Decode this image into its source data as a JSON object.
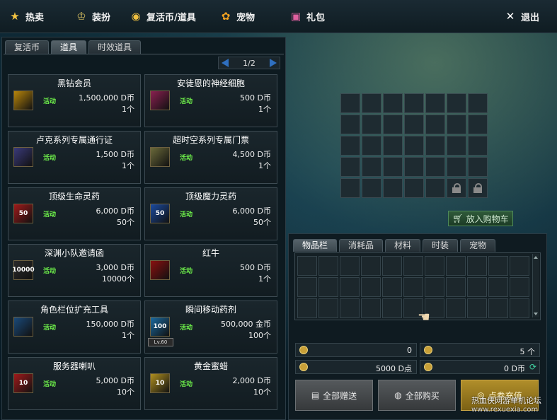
{
  "nav": {
    "hot": "热卖",
    "dress": "装扮",
    "revive": "复活币/道具",
    "pet": "宠物",
    "gift": "礼包",
    "exit": "退出"
  },
  "left": {
    "tabs": [
      "复活币",
      "道具",
      "时效道具"
    ],
    "active_tab": 1,
    "pager": "1/2",
    "items": [
      {
        "name": "黑钻会员",
        "badge": "活动",
        "price": "1,500,000 D币",
        "qty": "1个",
        "icon_color": "#b8860b",
        "icon_text": ""
      },
      {
        "name": "安徒恩的神经细胞",
        "badge": "活动",
        "price": "500 D币",
        "qty": "1个",
        "icon_color": "#8a2050",
        "icon_text": ""
      },
      {
        "name": "卢克系列专属通行证",
        "badge": "活动",
        "price": "1,500 D币",
        "qty": "1个",
        "icon_color": "#3a3a7a",
        "icon_text": ""
      },
      {
        "name": "超时空系列专属门票",
        "badge": "活动",
        "price": "4,500 D币",
        "qty": "1个",
        "icon_color": "#6b6a3a",
        "icon_text": ""
      },
      {
        "name": "顶级生命灵药",
        "badge": "活动",
        "price": "6,000 D币",
        "qty": "50个",
        "icon_color": "#a01a1a",
        "icon_text": "50"
      },
      {
        "name": "顶级魔力灵药",
        "badge": "活动",
        "price": "6,000 D币",
        "qty": "50个",
        "icon_color": "#1a4aa0",
        "icon_text": "50"
      },
      {
        "name": "深渊小队邀请函",
        "badge": "活动",
        "price": "3,000 D币",
        "qty": "10000个",
        "icon_color": "#2a2a2a",
        "icon_text": "10000"
      },
      {
        "name": "红牛",
        "badge": "活动",
        "price": "500 D币",
        "qty": "1个",
        "icon_color": "#8a1010",
        "icon_text": ""
      },
      {
        "name": "角色栏位扩充工具",
        "badge": "活动",
        "price": "150,000 D币",
        "qty": "1个",
        "icon_color": "#1a4a7a",
        "icon_text": ""
      },
      {
        "name": "瞬间移动药剂",
        "badge": "活动",
        "price": "500,000 金币",
        "qty": "100个",
        "icon_color": "#1a6aa0",
        "icon_text": "100",
        "level": "Lv.60"
      },
      {
        "name": "服务器喇叭",
        "badge": "活动",
        "price": "5,000 D币",
        "qty": "10个",
        "icon_color": "#a01a1a",
        "icon_text": "10"
      },
      {
        "name": "黄金蜜蜡",
        "badge": "活动",
        "price": "2,000 D币",
        "qty": "10个",
        "icon_color": "#b09020",
        "icon_text": "10"
      }
    ]
  },
  "preview": {
    "cart_button": "放入购物车"
  },
  "inventory": {
    "tabs": [
      "物品栏",
      "消耗品",
      "材料",
      "时装",
      "宠物"
    ],
    "active_tab": 0,
    "currency": {
      "gold": "0",
      "dpoint": "5000 D点",
      "count": "5 个",
      "dcoin": "0 D币"
    },
    "buttons": {
      "gift_all": "全部赠送",
      "buy_all": "全部购买",
      "recharge": "点卷充值"
    }
  },
  "watermark": {
    "line1": "热血侠网游单机论坛",
    "line2": "www.rexuexia.com"
  }
}
